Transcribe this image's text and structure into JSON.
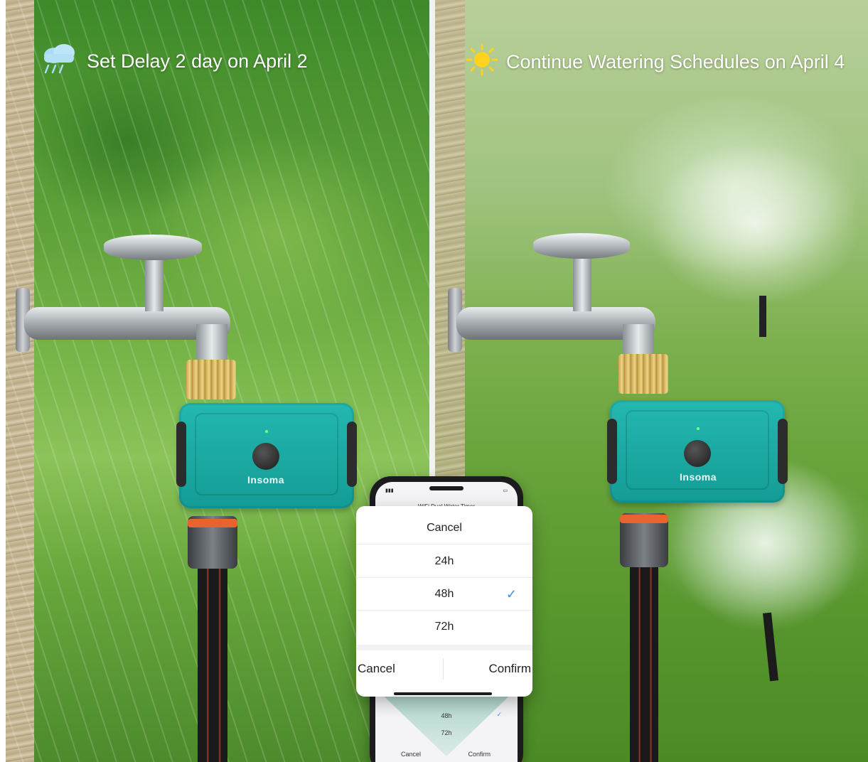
{
  "left_panel": {
    "caption": "Set Delay 2 day on April 2",
    "weather_icon": "rain-cloud-icon",
    "device_brand": "Insoma"
  },
  "right_panel": {
    "caption": "Continue Watering Schedules on April 4",
    "weather_icon": "sun-icon",
    "device_brand": "Insoma"
  },
  "phone": {
    "app_title": "WiFi Dual Water Timer",
    "background_rows": [
      "48h",
      "72h"
    ],
    "background_actions": {
      "cancel": "Cancel",
      "confirm": "Confirm"
    }
  },
  "delay_picker": {
    "header": "Cancel",
    "options": [
      {
        "label": "24h",
        "selected": false
      },
      {
        "label": "48h",
        "selected": true
      },
      {
        "label": "72h",
        "selected": false
      }
    ],
    "selected_icon": "checkmark-icon",
    "cancel_label": "Cancel",
    "confirm_label": "Confirm"
  },
  "colors": {
    "accent_green": "#2ea46a",
    "device_teal": "#1aa9a2",
    "check_blue": "#3d8fe4"
  }
}
